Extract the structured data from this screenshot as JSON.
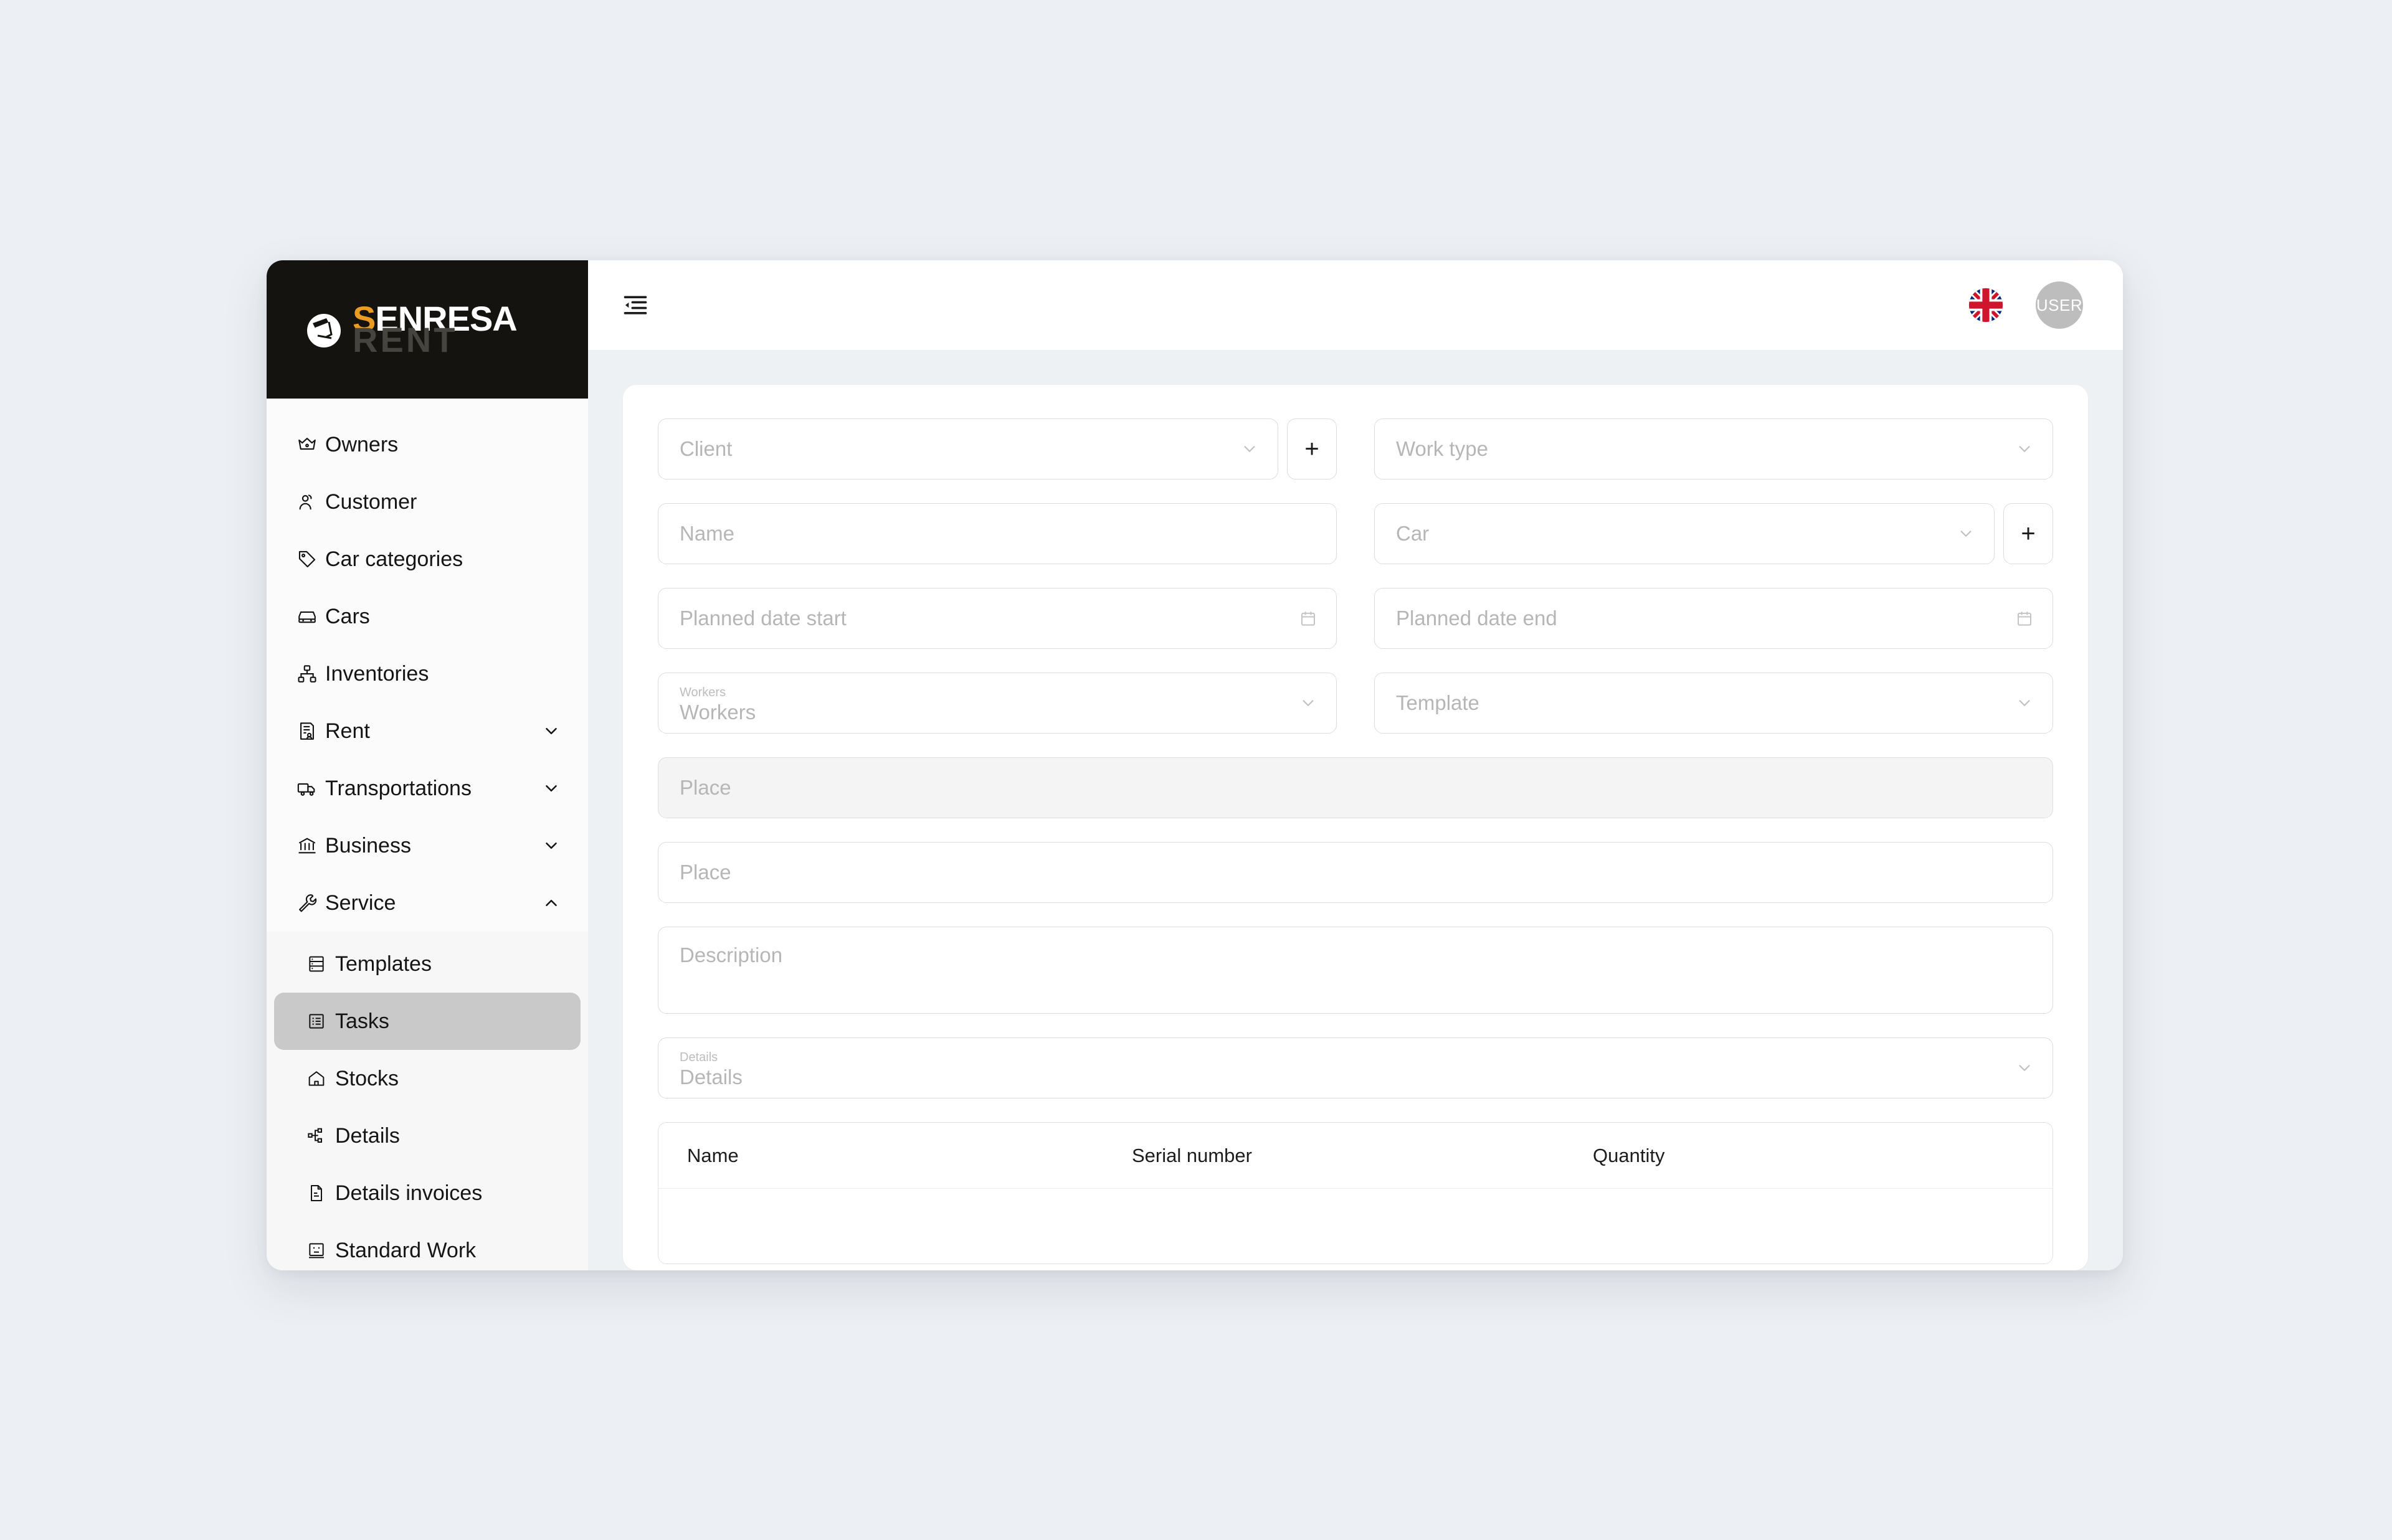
{
  "brand": {
    "logo_line1_accent": "S",
    "logo_line1_rest": "ENRESA",
    "logo_line2": "RENT",
    "accent_color": "#EB9A23",
    "logo_bg": "#141310"
  },
  "topbar": {
    "menu_fold_icon": "menu-fold-icon",
    "language_flag": "uk-flag-icon",
    "avatar_label": "USER"
  },
  "sidebar": {
    "items": [
      {
        "label": "Owners",
        "icon": "crown-icon",
        "expandable": false
      },
      {
        "label": "Customer",
        "icon": "customer-icon",
        "expandable": false
      },
      {
        "label": "Car categories",
        "icon": "tag-icon",
        "expandable": false
      },
      {
        "label": "Cars",
        "icon": "car-icon",
        "expandable": false
      },
      {
        "label": "Inventories",
        "icon": "hierarchy-icon",
        "expandable": false
      },
      {
        "label": "Rent",
        "icon": "contract-icon",
        "expandable": true,
        "expanded": false
      },
      {
        "label": "Transportations",
        "icon": "truck-icon",
        "expandable": true,
        "expanded": false
      },
      {
        "label": "Business",
        "icon": "bank-icon",
        "expandable": true,
        "expanded": false
      },
      {
        "label": "Service",
        "icon": "wrench-icon",
        "expandable": true,
        "expanded": true
      }
    ],
    "service_submenu": [
      {
        "label": "Templates",
        "icon": "server-icon",
        "active": false
      },
      {
        "label": "Tasks",
        "icon": "list-box-icon",
        "active": true
      },
      {
        "label": "Stocks",
        "icon": "home-icon",
        "active": false
      },
      {
        "label": "Details",
        "icon": "nodes-icon",
        "active": false
      },
      {
        "label": "Details invoices",
        "icon": "file-icon",
        "active": false
      },
      {
        "label": "Standard Work",
        "icon": "board-icon",
        "active": false
      }
    ]
  },
  "form": {
    "client": {
      "placeholder": "Client",
      "value": "",
      "has_dropdown": true,
      "add_button": "+"
    },
    "work_type": {
      "placeholder": "Work type",
      "value": "",
      "has_dropdown": true
    },
    "name": {
      "placeholder": "Name",
      "value": ""
    },
    "car": {
      "placeholder": "Car",
      "value": "",
      "has_dropdown": true,
      "add_button": "+"
    },
    "planned_date_start": {
      "placeholder": "Planned date start",
      "value": "",
      "icon": "calendar-icon"
    },
    "planned_date_end": {
      "placeholder": "Planned date end",
      "value": "",
      "icon": "calendar-icon"
    },
    "workers": {
      "label": "Workers",
      "placeholder": "Workers",
      "value": "",
      "has_dropdown": true
    },
    "template": {
      "placeholder": "Template",
      "value": "",
      "has_dropdown": true
    },
    "place_disabled": {
      "placeholder": "Place",
      "value": "",
      "disabled": true
    },
    "place": {
      "placeholder": "Place",
      "value": ""
    },
    "description": {
      "placeholder": "Description",
      "value": ""
    },
    "details": {
      "label": "Details",
      "placeholder": "Details",
      "value": "",
      "has_dropdown": true
    }
  },
  "details_table": {
    "columns": [
      "Name",
      "Serial number",
      "Quantity"
    ],
    "rows": []
  }
}
